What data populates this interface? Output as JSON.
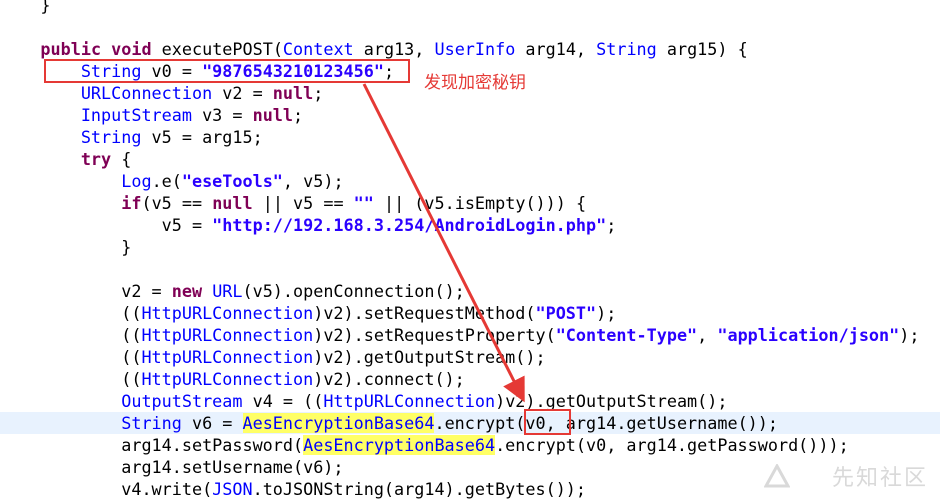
{
  "code_lines": [
    [
      {
        "t": "    }",
        "c": "pl"
      }
    ],
    [
      {
        "t": "",
        "c": "pl"
      }
    ],
    [
      {
        "t": "    ",
        "c": "pl"
      },
      {
        "t": "public",
        "c": "kw"
      },
      {
        "t": " ",
        "c": "pl"
      },
      {
        "t": "void",
        "c": "kw"
      },
      {
        "t": " executePOST(",
        "c": "pl"
      },
      {
        "t": "Context",
        "c": "ty"
      },
      {
        "t": " arg13, ",
        "c": "pl"
      },
      {
        "t": "UserInfo",
        "c": "ty"
      },
      {
        "t": " arg14, ",
        "c": "pl"
      },
      {
        "t": "String",
        "c": "ty"
      },
      {
        "t": " arg15) {",
        "c": "pl"
      }
    ],
    [
      {
        "t": "        ",
        "c": "pl"
      },
      {
        "t": "String",
        "c": "ty"
      },
      {
        "t": " v0 = ",
        "c": "pl"
      },
      {
        "t": "\"9876543210123456\"",
        "c": "st"
      },
      {
        "t": ";",
        "c": "pl"
      }
    ],
    [
      {
        "t": "        ",
        "c": "pl"
      },
      {
        "t": "URLConnection",
        "c": "ty"
      },
      {
        "t": " v2 = ",
        "c": "pl"
      },
      {
        "t": "null",
        "c": "lit"
      },
      {
        "t": ";",
        "c": "pl"
      }
    ],
    [
      {
        "t": "        ",
        "c": "pl"
      },
      {
        "t": "InputStream",
        "c": "ty"
      },
      {
        "t": " v3 = ",
        "c": "pl"
      },
      {
        "t": "null",
        "c": "lit"
      },
      {
        "t": ";",
        "c": "pl"
      }
    ],
    [
      {
        "t": "        ",
        "c": "pl"
      },
      {
        "t": "String",
        "c": "ty"
      },
      {
        "t": " v5 = arg15;",
        "c": "pl"
      }
    ],
    [
      {
        "t": "        ",
        "c": "pl"
      },
      {
        "t": "try",
        "c": "kw"
      },
      {
        "t": " {",
        "c": "pl"
      }
    ],
    [
      {
        "t": "            ",
        "c": "pl"
      },
      {
        "t": "Log",
        "c": "ty"
      },
      {
        "t": ".e(",
        "c": "pl"
      },
      {
        "t": "\"eseTools\"",
        "c": "st"
      },
      {
        "t": ", v5);",
        "c": "pl"
      }
    ],
    [
      {
        "t": "            ",
        "c": "pl"
      },
      {
        "t": "if",
        "c": "kw"
      },
      {
        "t": "(v5 == ",
        "c": "pl"
      },
      {
        "t": "null",
        "c": "lit"
      },
      {
        "t": " || v5 == ",
        "c": "pl"
      },
      {
        "t": "\"\"",
        "c": "st"
      },
      {
        "t": " || (v5.isEmpty())) {",
        "c": "pl"
      }
    ],
    [
      {
        "t": "                v5 = ",
        "c": "pl"
      },
      {
        "t": "\"http://192.168.3.254/AndroidLogin.php\"",
        "c": "st"
      },
      {
        "t": ";",
        "c": "pl"
      }
    ],
    [
      {
        "t": "            }",
        "c": "pl"
      }
    ],
    [
      {
        "t": "",
        "c": "pl"
      }
    ],
    [
      {
        "t": "            v2 = ",
        "c": "pl"
      },
      {
        "t": "new",
        "c": "kw"
      },
      {
        "t": " ",
        "c": "pl"
      },
      {
        "t": "URL",
        "c": "ty"
      },
      {
        "t": "(v5).openConnection();",
        "c": "pl"
      }
    ],
    [
      {
        "t": "            ((",
        "c": "pl"
      },
      {
        "t": "HttpURLConnection",
        "c": "ty"
      },
      {
        "t": ")v2).setRequestMethod(",
        "c": "pl"
      },
      {
        "t": "\"POST\"",
        "c": "st"
      },
      {
        "t": ");",
        "c": "pl"
      }
    ],
    [
      {
        "t": "            ((",
        "c": "pl"
      },
      {
        "t": "HttpURLConnection",
        "c": "ty"
      },
      {
        "t": ")v2).setRequestProperty(",
        "c": "pl"
      },
      {
        "t": "\"Content-Type\"",
        "c": "st"
      },
      {
        "t": ", ",
        "c": "pl"
      },
      {
        "t": "\"application/json\"",
        "c": "st"
      },
      {
        "t": ");",
        "c": "pl"
      }
    ],
    [
      {
        "t": "            ((",
        "c": "pl"
      },
      {
        "t": "HttpURLConnection",
        "c": "ty"
      },
      {
        "t": ")v2).getOutputStream();",
        "c": "pl"
      }
    ],
    [
      {
        "t": "            ((",
        "c": "pl"
      },
      {
        "t": "HttpURLConnection",
        "c": "ty"
      },
      {
        "t": ")v2).connect();",
        "c": "pl"
      }
    ],
    [
      {
        "t": "            ",
        "c": "pl"
      },
      {
        "t": "OutputStream",
        "c": "ty"
      },
      {
        "t": " v4 = ((",
        "c": "pl"
      },
      {
        "t": "HttpURLConnection",
        "c": "ty"
      },
      {
        "t": ")v2).getOutputStream();",
        "c": "pl"
      }
    ],
    [
      {
        "t": "            ",
        "c": "pl"
      },
      {
        "t": "String",
        "c": "ty"
      },
      {
        "t": " v6 = ",
        "c": "pl"
      },
      {
        "t": "AesEncryptionBase64",
        "c": "cl"
      },
      {
        "t": ".encrypt(v0, arg14.getUsername());",
        "c": "pl"
      }
    ],
    [
      {
        "t": "            arg14.setPassword(",
        "c": "pl"
      },
      {
        "t": "AesEncryptionBase64",
        "c": "cl"
      },
      {
        "t": ".encrypt(v0, arg14.getPassword()));",
        "c": "pl"
      }
    ],
    [
      {
        "t": "            arg14.setUsername(v6);",
        "c": "pl"
      }
    ],
    [
      {
        "t": "            v4.write(",
        "c": "pl"
      },
      {
        "t": "JSON",
        "c": "ty"
      },
      {
        "t": ".toJSONString(arg14).getBytes());",
        "c": "pl"
      }
    ]
  ],
  "current_line_index": 19,
  "annotation": {
    "note_text": "发现加密秘钥",
    "note_color": "#e53935"
  },
  "watermark": {
    "text": "先知社区"
  },
  "colors": {
    "keyword": "#7f0055",
    "type": "#0000ff",
    "string": "#2a00ff",
    "class_highlight": "#ffff66",
    "current_line": "#e8f2fe",
    "annotation_red": "#e53935"
  }
}
